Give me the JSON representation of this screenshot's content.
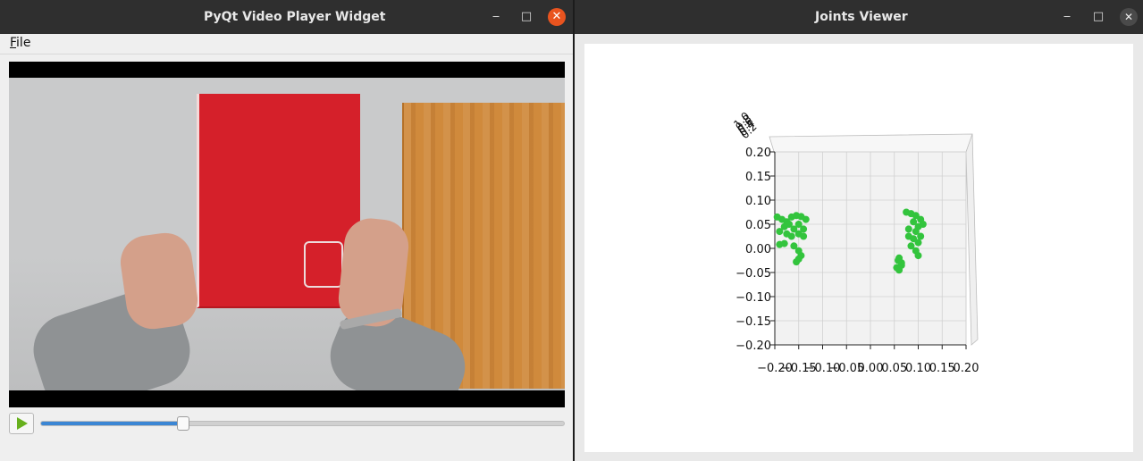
{
  "left_window": {
    "title": "PyQt Video Player Widget",
    "controls": {
      "minimize": "‒",
      "maximize": "□",
      "close": "✕"
    },
    "menu": {
      "file": "File"
    },
    "player": {
      "play_icon": "play-icon",
      "progress": 0.27
    }
  },
  "right_window": {
    "title": "Joints Viewer",
    "controls": {
      "minimize": "‒",
      "maximize": "□",
      "close": "✕"
    }
  },
  "chart_data": {
    "type": "scatter",
    "title": "",
    "xlabel": "",
    "ylabel": "",
    "xlim": [
      -0.2,
      0.2
    ],
    "ylim": [
      -0.2,
      0.2
    ],
    "xticks": [
      "−0.20",
      "−0.15",
      "−0.10",
      "−0.05",
      "0.00",
      "0.05",
      "0.10",
      "0.15",
      "0.20"
    ],
    "yticks": [
      "0.20",
      "0.15",
      "0.10",
      "0.05",
      "0.00",
      "−0.05",
      "−0.10",
      "−0.15",
      "−0.20"
    ],
    "z_tick_labels": [
      "1.0",
      "0.8",
      "0.6",
      "0.4",
      "0.2"
    ],
    "point_color": "#33c43d",
    "grid": true,
    "series": [
      {
        "x": [
          -0.195,
          -0.185,
          -0.175,
          -0.165,
          -0.155,
          -0.145,
          -0.135,
          -0.18,
          -0.17,
          -0.16,
          -0.15,
          -0.14,
          -0.19,
          -0.175,
          -0.165,
          -0.15,
          -0.14,
          -0.19,
          -0.18,
          -0.16,
          -0.15,
          -0.145,
          -0.15,
          -0.155
        ],
        "y": [
          0.065,
          0.06,
          0.055,
          0.065,
          0.068,
          0.066,
          0.06,
          0.045,
          0.05,
          0.04,
          0.05,
          0.04,
          0.035,
          0.03,
          0.025,
          0.03,
          0.025,
          0.008,
          0.01,
          0.005,
          -0.005,
          -0.015,
          -0.022,
          -0.028
        ]
      },
      {
        "x": [
          0.075,
          0.085,
          0.095,
          0.105,
          0.11,
          0.09,
          0.1,
          0.08,
          0.095,
          0.105,
          0.08,
          0.09,
          0.1,
          0.085,
          0.095,
          0.1,
          0.06,
          0.065,
          0.055,
          0.06,
          0.065,
          0.058
        ],
        "y": [
          0.075,
          0.072,
          0.068,
          0.06,
          0.05,
          0.055,
          0.045,
          0.04,
          0.035,
          0.025,
          0.025,
          0.02,
          0.012,
          0.005,
          -0.005,
          -0.015,
          -0.02,
          -0.03,
          -0.04,
          -0.045,
          -0.035,
          -0.025
        ]
      }
    ]
  }
}
